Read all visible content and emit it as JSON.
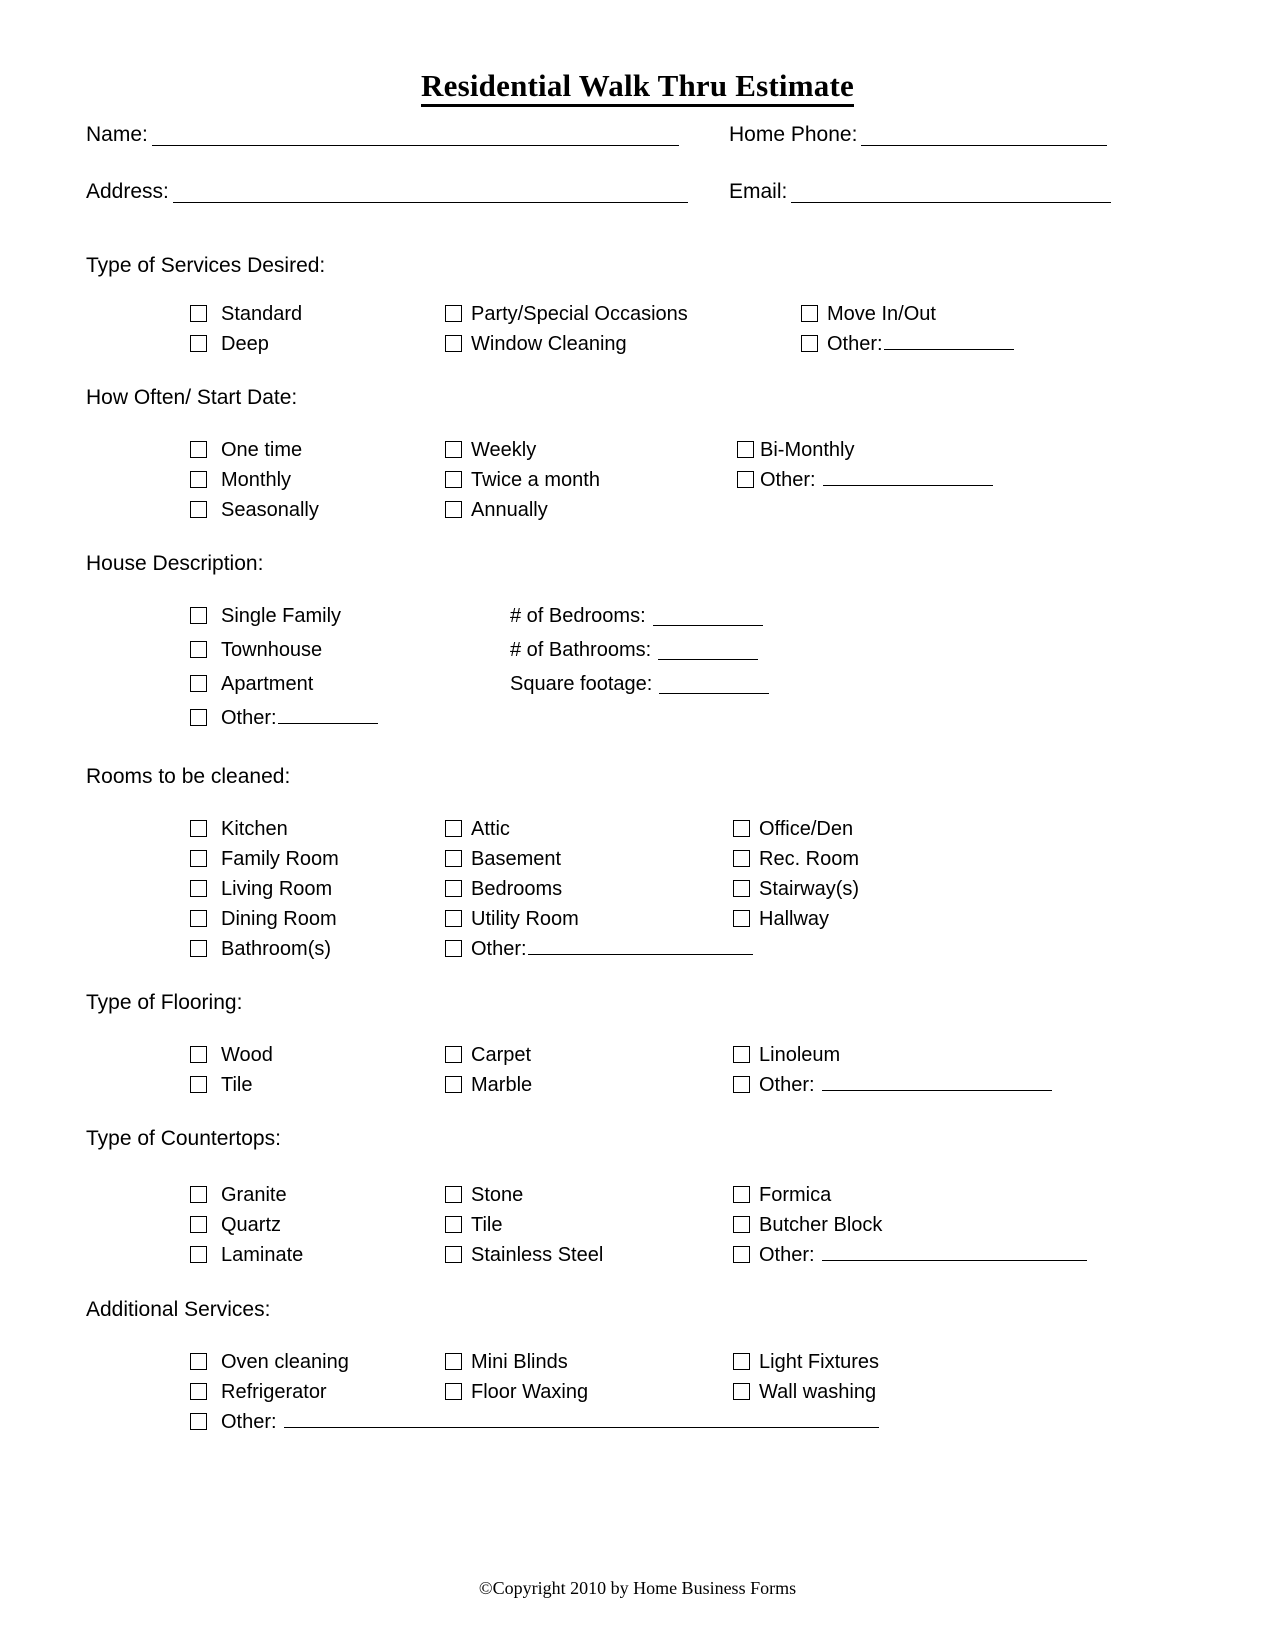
{
  "document": {
    "title": "Residential Walk Thru Estimate",
    "footer": "©Copyright 2010 by Home Business Forms"
  },
  "contact": {
    "name_label": "Name:",
    "name_value": "",
    "home_phone_label": "Home Phone:",
    "home_phone_value": "",
    "address_label": "Address:",
    "address_value": "",
    "email_label": "Email:",
    "email_value": ""
  },
  "services": {
    "heading": "Type of Services Desired:",
    "col1": [
      "Standard",
      "Deep"
    ],
    "col2": [
      "Party/Special Occasions",
      "Window Cleaning"
    ],
    "col3": [
      "Move In/Out",
      "Other:"
    ],
    "other_value": ""
  },
  "frequency": {
    "heading": "How Often/ Start Date:",
    "col1": [
      "One time",
      "Monthly",
      "Seasonally"
    ],
    "col2": [
      "Weekly",
      "Twice a month",
      "Annually"
    ],
    "col3": [
      "Bi-Monthly",
      "Other:"
    ],
    "other_value": ""
  },
  "house": {
    "heading": "House Description:",
    "col1": [
      "Single Family",
      "Townhouse",
      "Apartment",
      "Other:"
    ],
    "other_value": "",
    "fields": [
      {
        "label": "# of Bedrooms:",
        "value": ""
      },
      {
        "label": "# of Bathrooms:",
        "value": ""
      },
      {
        "label": "Square footage:",
        "value": ""
      }
    ]
  },
  "rooms": {
    "heading": "Rooms to be cleaned:",
    "col1": [
      "Kitchen",
      "Family Room",
      "Living Room",
      "Dining Room",
      "Bathroom(s)"
    ],
    "col2": [
      "Attic",
      "Basement",
      "Bedrooms",
      "Utility Room",
      "Other:"
    ],
    "col3": [
      "Office/Den",
      "Rec. Room",
      "Stairway(s)",
      "Hallway"
    ],
    "other_value": ""
  },
  "flooring": {
    "heading": "Type of Flooring:",
    "col1": [
      "Wood",
      "Tile"
    ],
    "col2": [
      "Carpet",
      "Marble"
    ],
    "col3": [
      "Linoleum",
      "Other:"
    ],
    "other_value": ""
  },
  "countertops": {
    "heading": "Type of Countertops:",
    "col1": [
      "Granite",
      "Quartz",
      "Laminate"
    ],
    "col2": [
      "Stone",
      "Tile",
      "Stainless Steel"
    ],
    "col3": [
      "Formica",
      "Butcher Block",
      "Other:"
    ],
    "other_value": ""
  },
  "additional": {
    "heading": "Additional Services:",
    "col1": [
      "Oven cleaning",
      "Refrigerator"
    ],
    "col2": [
      "Mini Blinds",
      "Floor Waxing"
    ],
    "col3": [
      "Light Fixtures",
      "Wall washing"
    ],
    "other_label": "Other:",
    "other_value": ""
  }
}
